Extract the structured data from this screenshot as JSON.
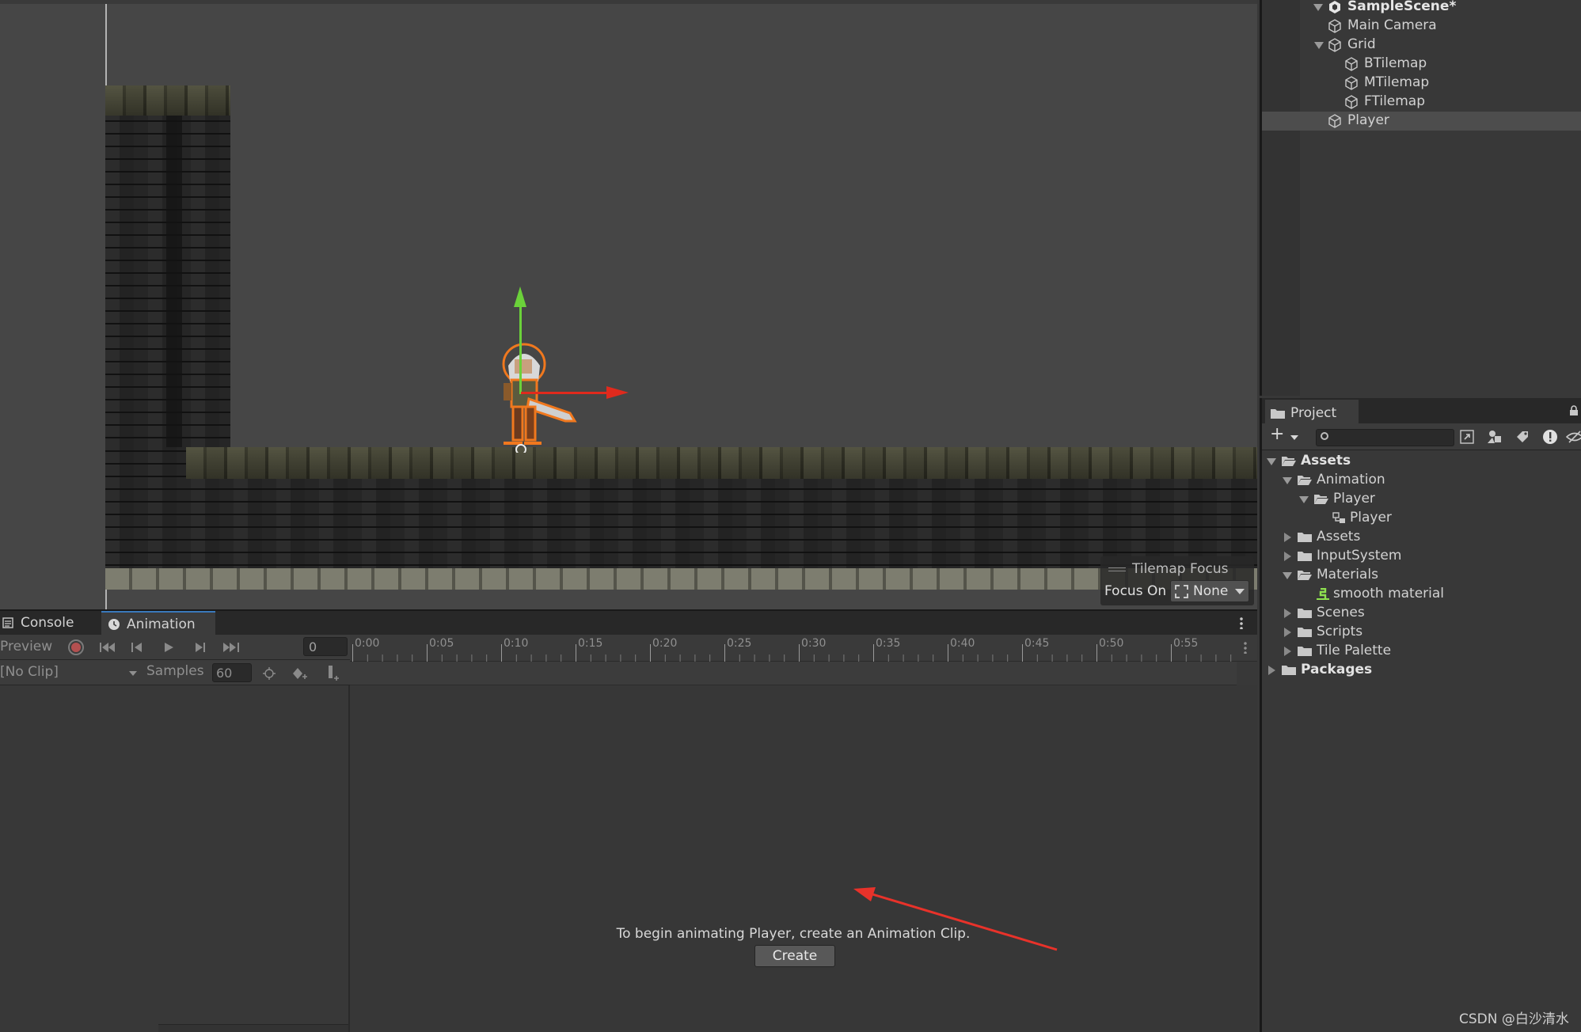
{
  "hierarchy": {
    "scene_name": "SampleScene*",
    "items": [
      {
        "label": "Main Camera"
      },
      {
        "label": "Grid"
      },
      {
        "label": "BTilemap"
      },
      {
        "label": "MTilemap"
      },
      {
        "label": "FTilemap"
      },
      {
        "label": "Player"
      }
    ]
  },
  "scene_overlay": {
    "title": "Tilemap Focus",
    "focus_label": "Focus On",
    "focus_value": "None"
  },
  "project": {
    "tab_label": "Project",
    "search_placeholder": "",
    "tree": {
      "assets": "Assets",
      "animation": "Animation",
      "player_folder": "Player",
      "player_controller": "Player",
      "assets_sub": "Assets",
      "input_system": "InputSystem",
      "materials": "Materials",
      "smooth_material": "smooth material",
      "scenes": "Scenes",
      "scripts": "Scripts",
      "tile_palette": "Tile Palette",
      "packages": "Packages"
    }
  },
  "animation": {
    "tabs": {
      "console": "Console",
      "animation": "Animation"
    },
    "preview_label": "Preview",
    "frame_value": "0",
    "clip_value": "[No Clip]",
    "samples_label": "Samples",
    "samples_value": "60",
    "timeline_labels": [
      "0:00",
      "0:05",
      "0:10",
      "0:15",
      "0:20",
      "0:25",
      "0:30",
      "0:35",
      "0:40",
      "0:45",
      "0:50",
      "0:55"
    ],
    "empty_message": "To begin animating Player, create an Animation Clip.",
    "create_label": "Create"
  },
  "colors": {
    "accent_tab": "#3a79bb",
    "gizmo_y": "#6bd13a",
    "gizmo_x": "#e02a1d",
    "annotation_arrow": "#e8322a"
  },
  "watermark": "CSDN @白沙清水"
}
